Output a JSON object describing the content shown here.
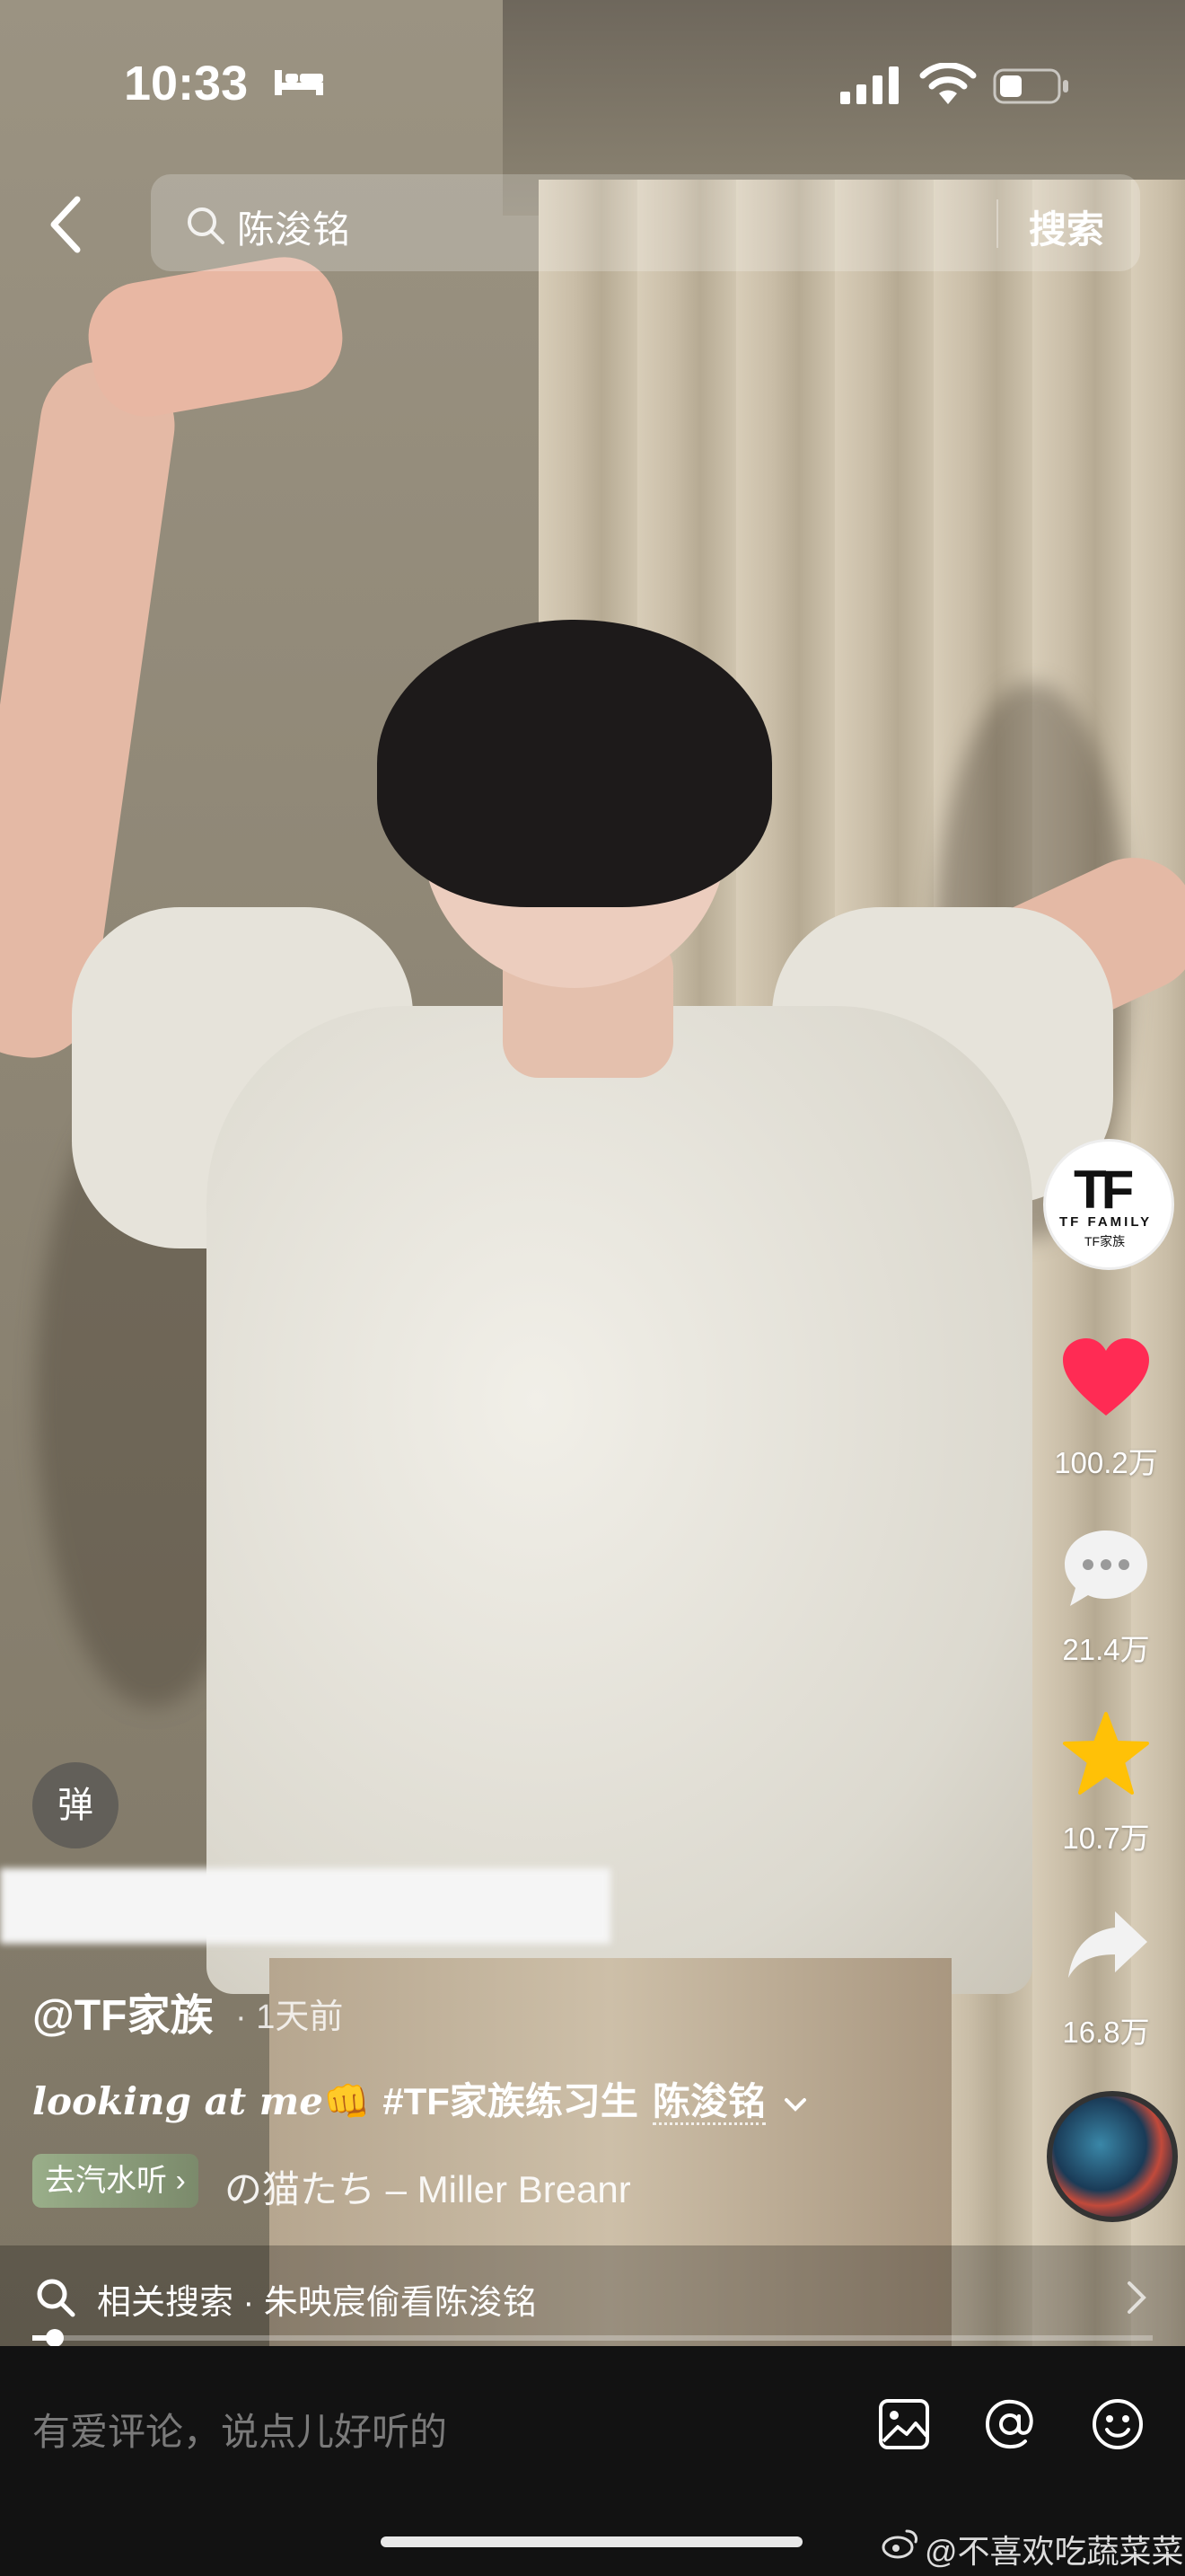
{
  "status_bar": {
    "time": "10:33"
  },
  "search": {
    "query": "陈浚铭",
    "button_label": "搜索"
  },
  "rail": {
    "account_logo": "TF",
    "account_line1": "TF FAMILY",
    "account_line2": "TF家族",
    "likes": "100.2万",
    "comments": "21.4万",
    "favorites": "10.7万",
    "shares": "16.8万",
    "like_color": "#ff2b54",
    "favorite_color": "#ffc107"
  },
  "danmaku_label": "弹",
  "author": {
    "name": "@TF家族",
    "time": "· 1天前"
  },
  "caption": {
    "script_text": "looking at me",
    "emoji": "👊",
    "hashtag": "#TF家族练习生",
    "mention": "陈浚铭"
  },
  "music": {
    "tag_label": "去汽水听 ›",
    "title": "の猫たち – Miller Breanr"
  },
  "related_search": {
    "label": "相关搜索 · 朱映宸偷看陈浚铭"
  },
  "progress": {
    "fraction": 0.02
  },
  "comment_bar": {
    "placeholder": "有爱评论，说点儿好听的"
  },
  "watermark": "@不喜欢吃蔬菜菜",
  "icons": [
    "bed-icon",
    "signal-icon",
    "wifi-icon",
    "battery-icon",
    "back-icon",
    "search-icon",
    "heart-icon",
    "comment-icon",
    "star-icon",
    "share-icon",
    "image-icon",
    "at-icon",
    "emoji-icon",
    "weibo-icon"
  ]
}
